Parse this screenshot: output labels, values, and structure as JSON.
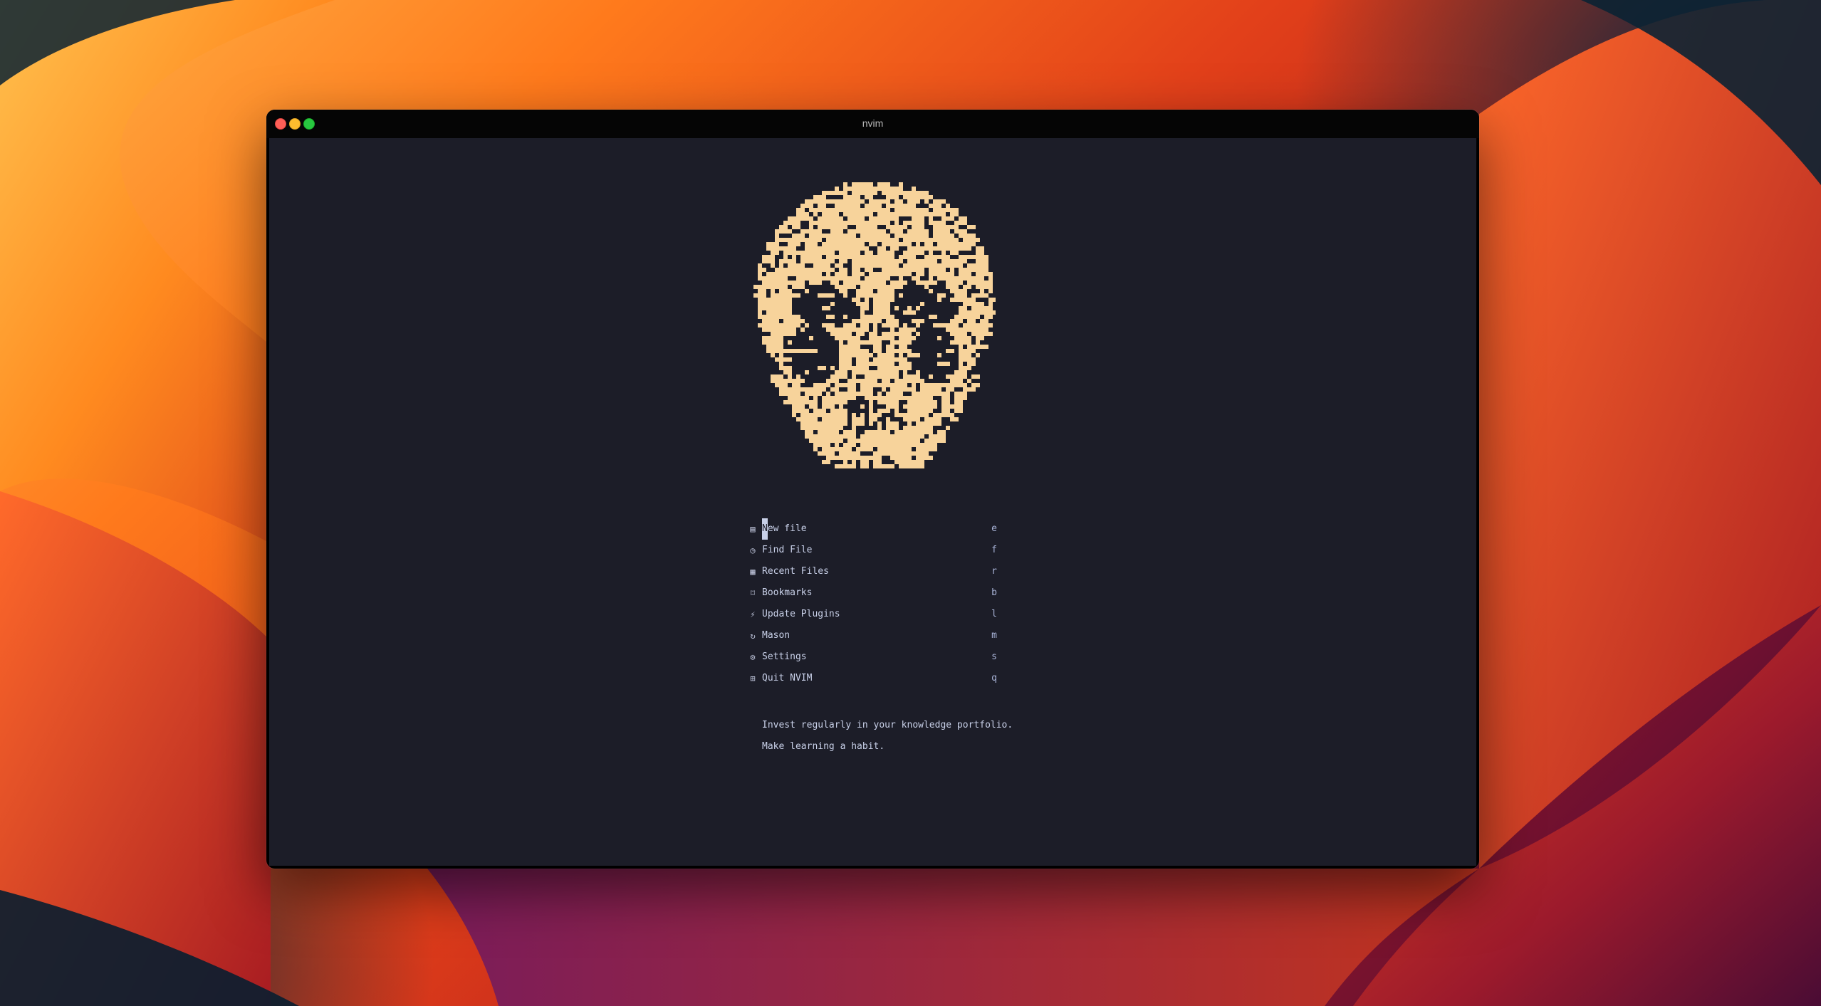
{
  "window": {
    "title": "nvim"
  },
  "dashboard": {
    "logo_color": "#f7d39b",
    "menu": [
      {
        "icon": "file-icon",
        "glyph": "▤",
        "cursor_char": "N",
        "label_rest": "ew file",
        "label": "New file",
        "key": "e"
      },
      {
        "icon": "clock-history-icon",
        "glyph": "◷",
        "label": "Find File",
        "key": "f"
      },
      {
        "icon": "recent-list-icon",
        "glyph": "▦",
        "label": "Recent Files",
        "key": "r"
      },
      {
        "icon": "bookmark-icon",
        "glyph": "⌑",
        "label": "Bookmarks",
        "key": "b"
      },
      {
        "icon": "plug-icon",
        "glyph": "⚡",
        "label": "Update Plugins",
        "key": "l"
      },
      {
        "icon": "refresh-icon",
        "glyph": "↻",
        "label": "Mason",
        "key": "m"
      },
      {
        "icon": "gear-icon",
        "glyph": "⚙",
        "label": "Settings",
        "key": "s"
      },
      {
        "icon": "quit-icon",
        "glyph": "⊞",
        "label": "Quit NVIM",
        "key": "q"
      }
    ],
    "quote": [
      "Invest regularly in your knowledge portfolio.",
      "Make learning a habit."
    ]
  },
  "colors": {
    "terminal_bg": "#1c1d28",
    "text": "#c8d0e8",
    "accent_logo": "#f7d39b"
  }
}
